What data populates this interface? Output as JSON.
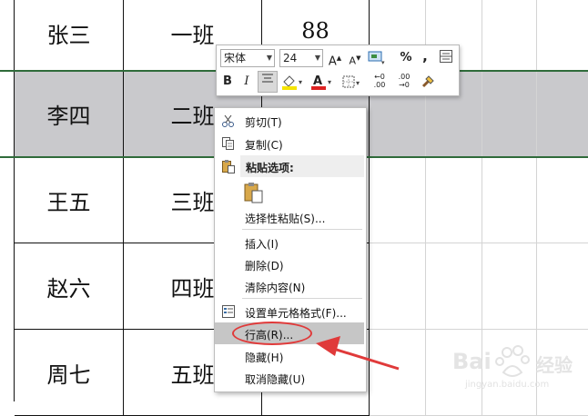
{
  "rows": [
    {
      "name": "张三",
      "class": "一班",
      "score": "88"
    },
    {
      "name": "李四",
      "class": "二班",
      "score": ""
    },
    {
      "name": "王五",
      "class": "三班",
      "score": ""
    },
    {
      "name": "赵六",
      "class": "四班",
      "score": ""
    },
    {
      "name": "周七",
      "class": "五班",
      "score": ""
    }
  ],
  "minibar": {
    "font": "宋体",
    "size": "24",
    "bold": "B",
    "italic": "I",
    "percent": "%",
    "comma": ","
  },
  "menu": {
    "cut": "剪切(T)",
    "copy": "复制(C)",
    "paste_options": "粘贴选项:",
    "paste_special": "选择性粘贴(S)...",
    "insert": "插入(I)",
    "delete": "删除(D)",
    "clear": "清除内容(N)",
    "format_cells": "设置单元格格式(F)...",
    "row_height": "行高(R)...",
    "hide": "隐藏(H)",
    "unhide": "取消隐藏(U)"
  },
  "watermark": {
    "line1": "Bai",
    "line2": "jingyan.baidu.com",
    "brand": "经验"
  },
  "colors": {
    "highlight_row": "#c9c9cc",
    "annotation": "#e03a3a",
    "row_border": "#2f6b3a"
  }
}
